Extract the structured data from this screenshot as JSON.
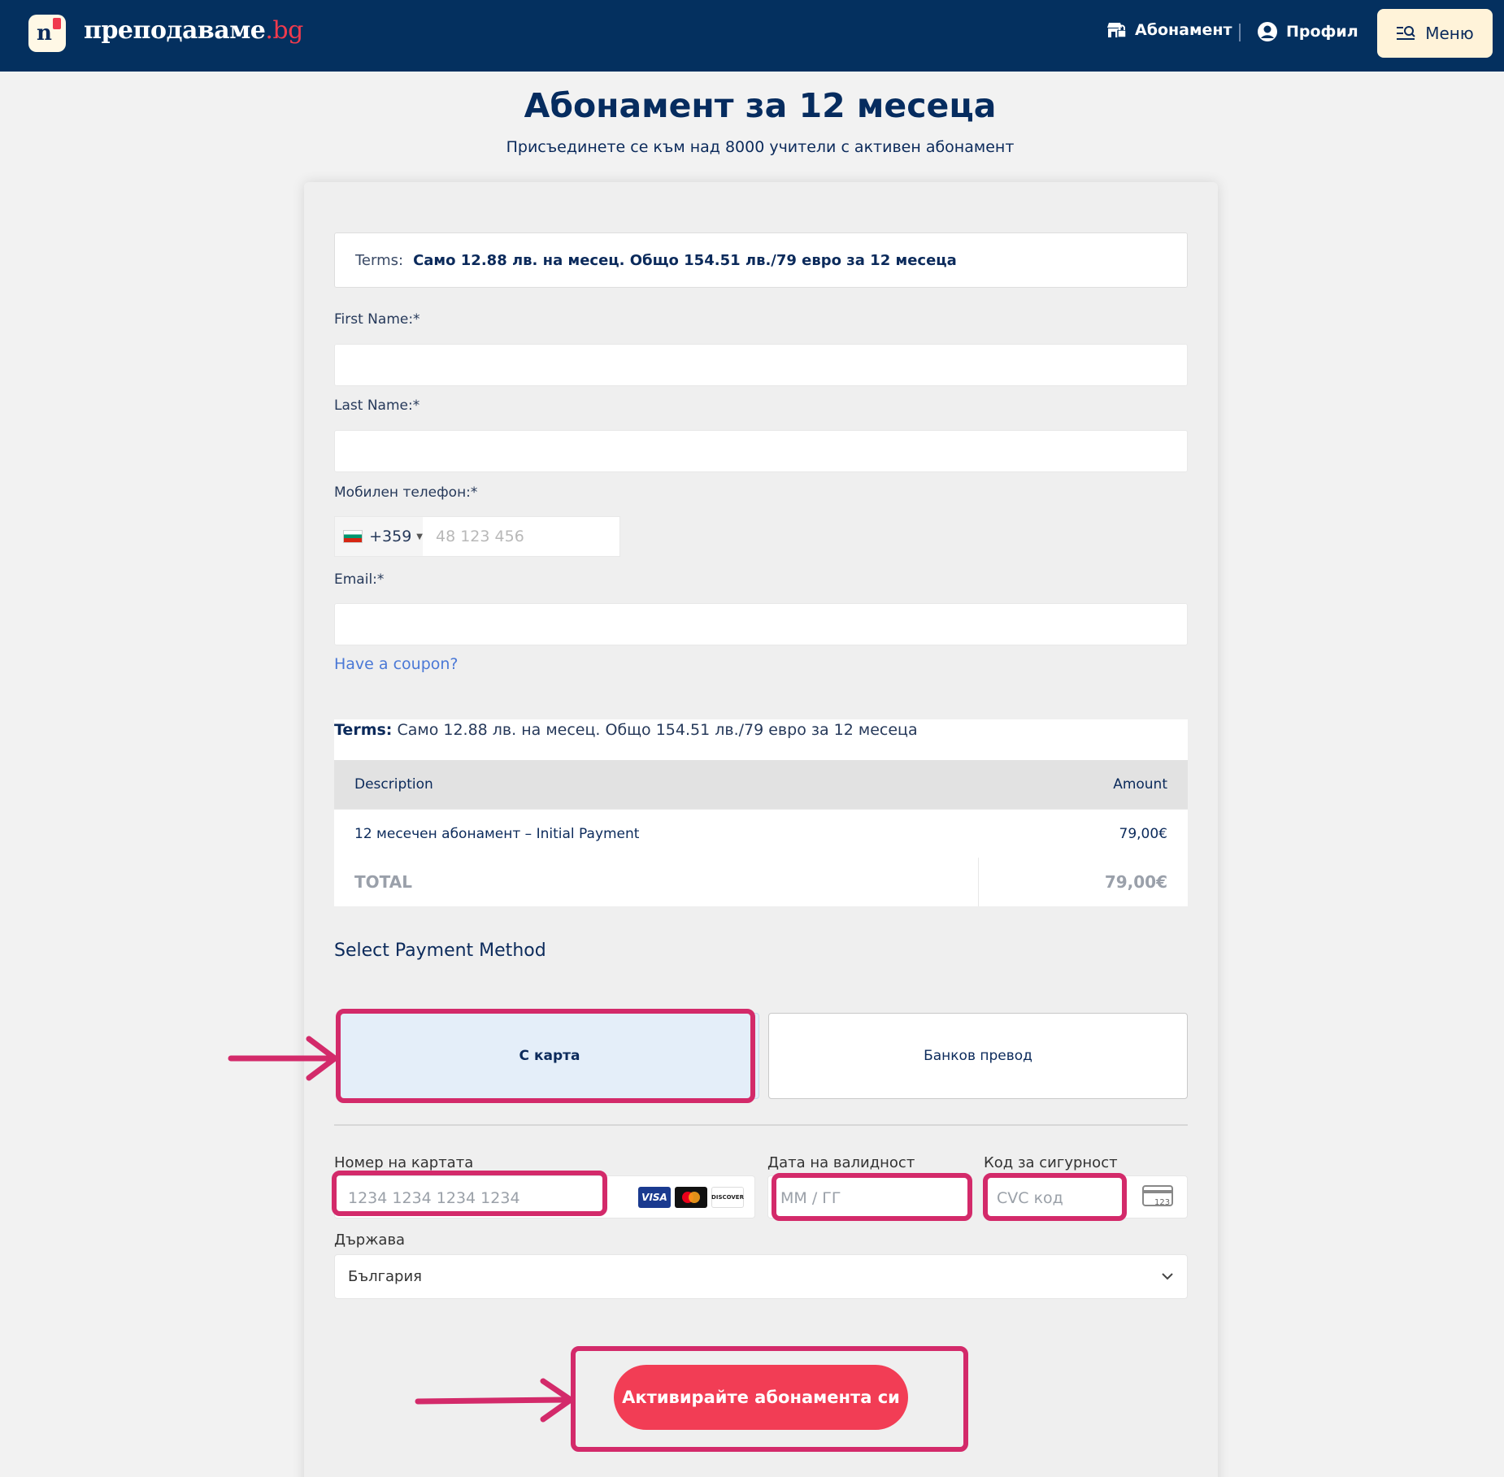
{
  "header": {
    "brand_name": "преподаваме",
    "brand_tld": ".bg",
    "logo_letter": "n",
    "nav_subscription": "Абонамент",
    "nav_profile": "Профил",
    "menu_label": "Меню"
  },
  "page": {
    "title": "Абонамент за 12 месеца",
    "subtitle": "Присъединете се към над 8000 учители с активен абонамент"
  },
  "form": {
    "terms_label": "Terms:",
    "terms_value": "Само 12.88 лв. на месец. Общо 154.51 лв./79 евро за 12 месеца",
    "first_name_label": "First Name:*",
    "last_name_label": "Last Name:*",
    "phone_label": "Мобилен телефон:*",
    "phone_code": "+359",
    "phone_placeholder": "48 123 456",
    "email_label": "Email:*",
    "coupon_link": "Have a coupon?"
  },
  "invoice": {
    "terms_label": "Terms:",
    "terms_value": "Само 12.88 лв. на месец. Общо 154.51 лв./79 евро за 12 месеца",
    "col_description": "Description",
    "col_amount": "Amount",
    "item_description": "12 месечен абонамент – Initial Payment",
    "item_amount": "79,00€",
    "total_label": "TOTAL",
    "total_amount": "79,00€"
  },
  "payment": {
    "heading": "Select Payment Method",
    "option_card": "С карта",
    "option_bank": "Банков превод",
    "selected": "С карта",
    "card_number_label": "Номер на картата",
    "card_number_placeholder": "1234 1234 1234 1234",
    "expiry_label": "Дата на валидност",
    "expiry_placeholder": "ММ / ГГ",
    "cvc_label": "Код за сигурност",
    "cvc_placeholder": "CVC код",
    "cvc_icon_text": "123",
    "card_brands": [
      "VISA",
      "Mastercard",
      "DISCOVER"
    ],
    "country_label": "Държава",
    "country_value": "България",
    "submit_label": "Активирайте абонамента си"
  },
  "colors": {
    "header_bg": "#04305f",
    "accent_red": "#f23d55",
    "highlight": "#d32a6a",
    "link_blue": "#4a78d6"
  }
}
